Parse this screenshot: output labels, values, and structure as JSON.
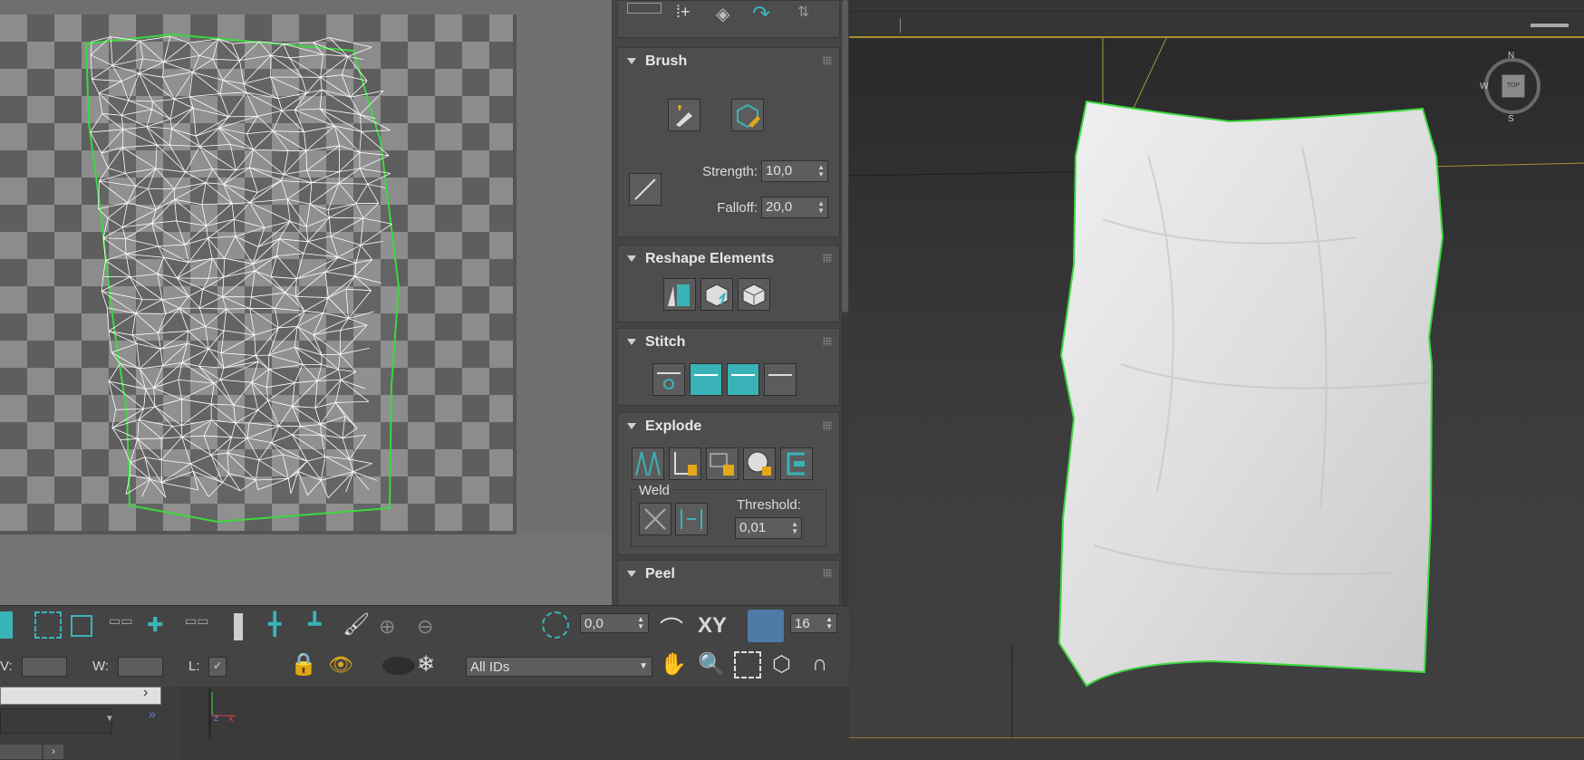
{
  "panel": {
    "brush": {
      "title": "Brush",
      "strength_label": "Strength:",
      "strength_value": "10,0",
      "falloff_label": "Falloff:",
      "falloff_value": "20,0"
    },
    "reshape": {
      "title": "Reshape Elements"
    },
    "stitch": {
      "title": "Stitch"
    },
    "explode": {
      "title": "Explode",
      "weld_label": "Weld",
      "threshold_label": "Threshold:",
      "threshold_value": "0,01"
    },
    "peel": {
      "title": "Peel"
    }
  },
  "toolbar": {
    "soft_value": "0,0",
    "xy_label": "XY",
    "grid_value": "16",
    "v_label": "V:",
    "w_label": "W:",
    "l_label": "L:",
    "id_filter": "All IDs"
  },
  "viewport": {
    "compass_n": "N",
    "compass_s": "S",
    "compass_w": "W",
    "viewcube_top": "TOP"
  },
  "colors": {
    "accent_teal": "#39b3b8",
    "selection_green": "#3cd83c",
    "gold": "#e2a81a"
  }
}
